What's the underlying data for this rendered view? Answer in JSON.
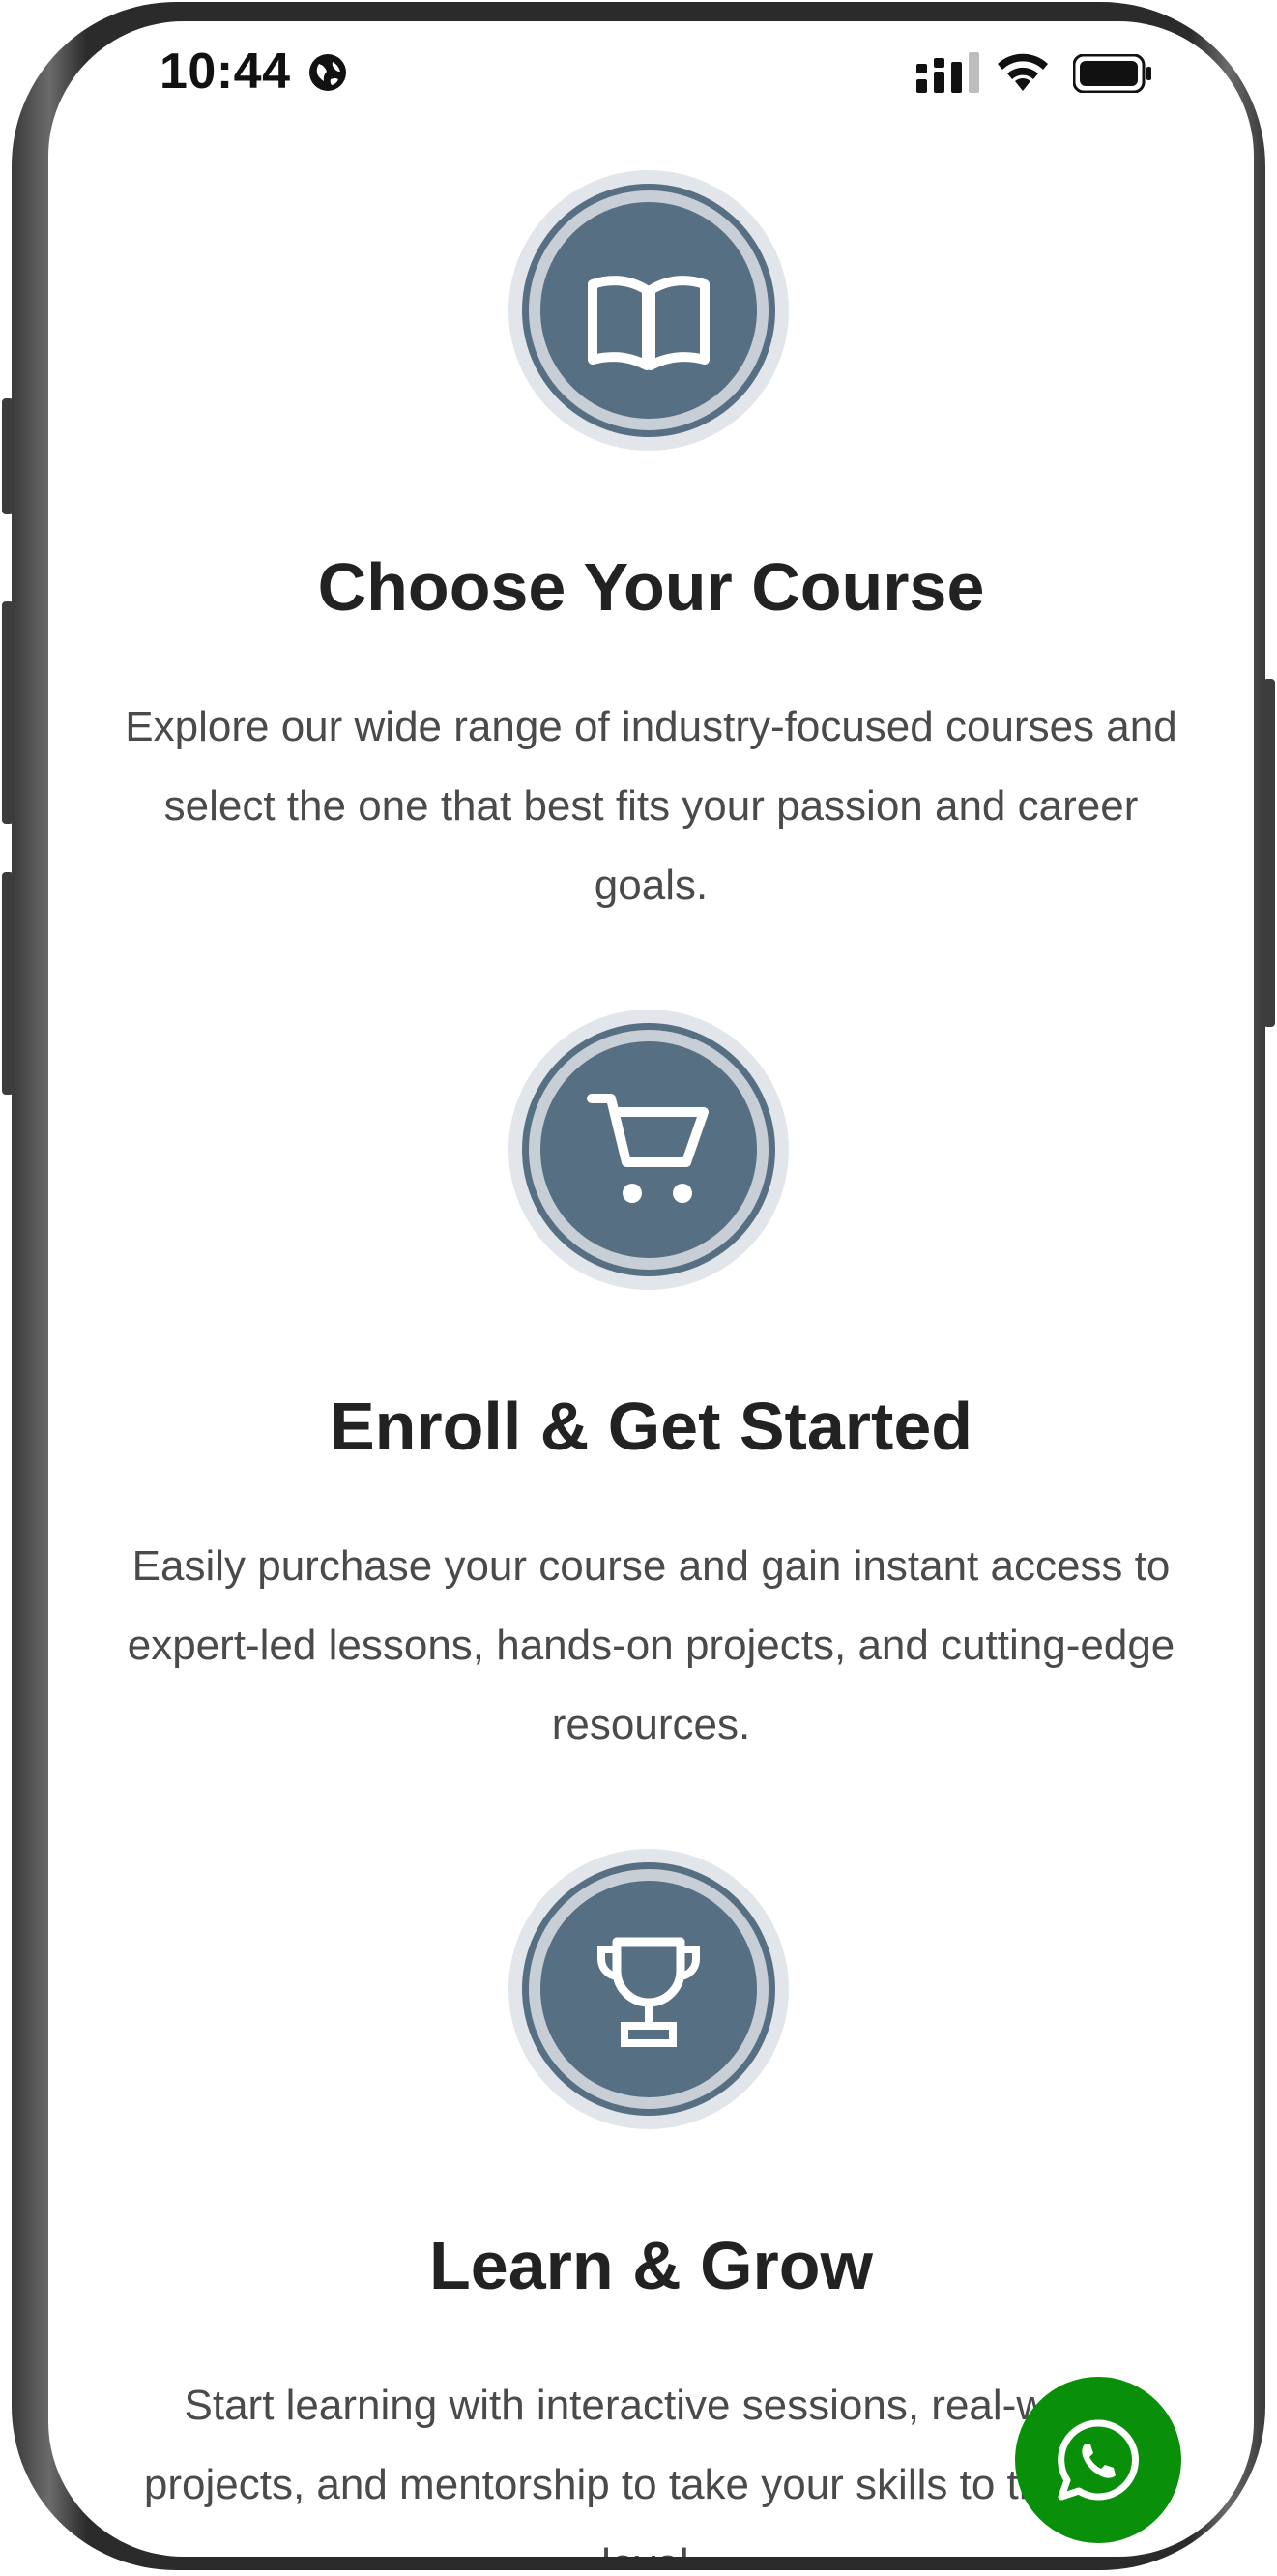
{
  "status_bar": {
    "time": "10:44",
    "icons": [
      "globe-icon",
      "cellular-signal-icon",
      "wifi-icon",
      "battery-icon"
    ]
  },
  "steps": [
    {
      "icon": "open-book-icon",
      "title": "Choose Your Course",
      "description": "Explore our wide range of industry-focused courses and select the one that best fits your passion and career goals."
    },
    {
      "icon": "shopping-cart-icon",
      "title": "Enroll & Get Started",
      "description": "Easily purchase your course and gain instant access to expert-led lessons, hands-on projects, and cutting-edge resources."
    },
    {
      "icon": "trophy-icon",
      "title": "Learn & Grow",
      "description": "Start learning with interactive sessions, real-world projects, and mentorship to take your skills to the next level."
    }
  ],
  "floating_action": {
    "icon": "whatsapp-icon"
  },
  "colors": {
    "badge_fill": "#576f82",
    "badge_ring": "#c7ced5",
    "badge_halo": "#e2e6ea",
    "heading": "#222222",
    "body_text": "#4a4a4a",
    "whatsapp_green": "#0a8f0a"
  }
}
